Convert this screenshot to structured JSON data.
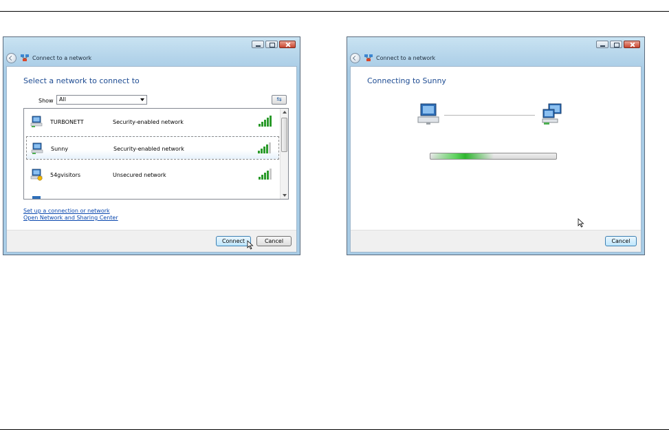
{
  "left_window": {
    "title": "Connect to a network",
    "heading": "Select a network to connect to",
    "show_label": "Show",
    "show_value": "All",
    "networks": [
      {
        "name": "TURBONETT",
        "security": "Security-enabled network",
        "signal": 5
      },
      {
        "name": "Sunny",
        "security": "Security-enabled network",
        "signal": 4
      },
      {
        "name": "54gvisitors",
        "security": "Unsecured network",
        "signal": 4
      }
    ],
    "links": [
      "Set up a connection or network",
      "Open Network and Sharing Center"
    ],
    "connect_label": "Connect",
    "cancel_label": "Cancel"
  },
  "right_window": {
    "title": "Connect to a network",
    "heading": "Connecting to Sunny",
    "progress_fraction": 0.5,
    "cancel_label": "Cancel"
  },
  "icons": [
    "back-arrow-icon",
    "network-icon",
    "minimize-icon",
    "maximize-icon",
    "close-icon",
    "refresh-icon",
    "computer-icon",
    "signal-bars-icon",
    "mouse-cursor-icon"
  ]
}
